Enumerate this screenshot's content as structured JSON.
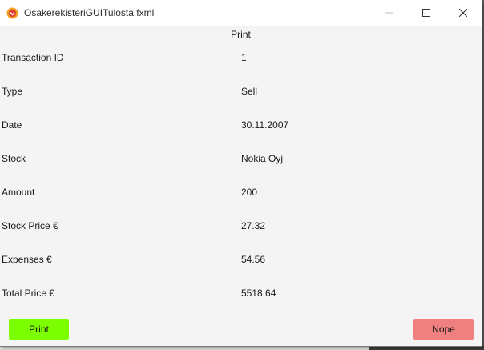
{
  "window": {
    "title": "OsakerekisteriGUITulosta.fxml",
    "controls": {
      "minimize": "minimize-icon",
      "maximize": "maximize-icon",
      "close": "close-icon"
    }
  },
  "form": {
    "heading": "Print",
    "rows": [
      {
        "label": "Transaction ID",
        "value": "1"
      },
      {
        "label": "Type",
        "value": "Sell"
      },
      {
        "label": "Date",
        "value": "30.11.2007"
      },
      {
        "label": "Stock",
        "value": "Nokia Oyj"
      },
      {
        "label": "Amount",
        "value": "200"
      },
      {
        "label": "Stock Price €",
        "value": "27.32"
      },
      {
        "label": "Expenses €",
        "value": "54.56"
      },
      {
        "label": "Total Price €",
        "value": "5518.64"
      }
    ]
  },
  "buttons": {
    "print_label": "Print",
    "nope_label": "Nope",
    "print_color": "#7cff00",
    "nope_color": "#f08080"
  }
}
